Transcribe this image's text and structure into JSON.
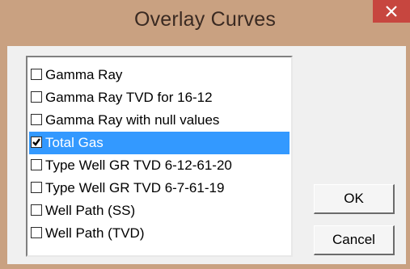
{
  "window": {
    "title": "Overlay Curves",
    "close_icon": "close-icon"
  },
  "curve_list": {
    "items": [
      {
        "label": "Gamma Ray",
        "checked": false,
        "selected": false
      },
      {
        "label": "Gamma Ray TVD for 16-12",
        "checked": false,
        "selected": false
      },
      {
        "label": "Gamma Ray with null values",
        "checked": false,
        "selected": false
      },
      {
        "label": "Total Gas",
        "checked": true,
        "selected": true
      },
      {
        "label": "Type Well GR TVD 6-12-61-20",
        "checked": false,
        "selected": false
      },
      {
        "label": "Type Well GR TVD 6-7-61-19",
        "checked": false,
        "selected": false
      },
      {
        "label": "Well Path (SS)",
        "checked": false,
        "selected": false
      },
      {
        "label": "Well Path (TVD)",
        "checked": false,
        "selected": false
      }
    ]
  },
  "buttons": {
    "ok_label": "OK",
    "cancel_label": "Cancel"
  },
  "colors": {
    "titlebar": "#c9a181",
    "close_button": "#c7463f",
    "selection": "#3399ff"
  }
}
